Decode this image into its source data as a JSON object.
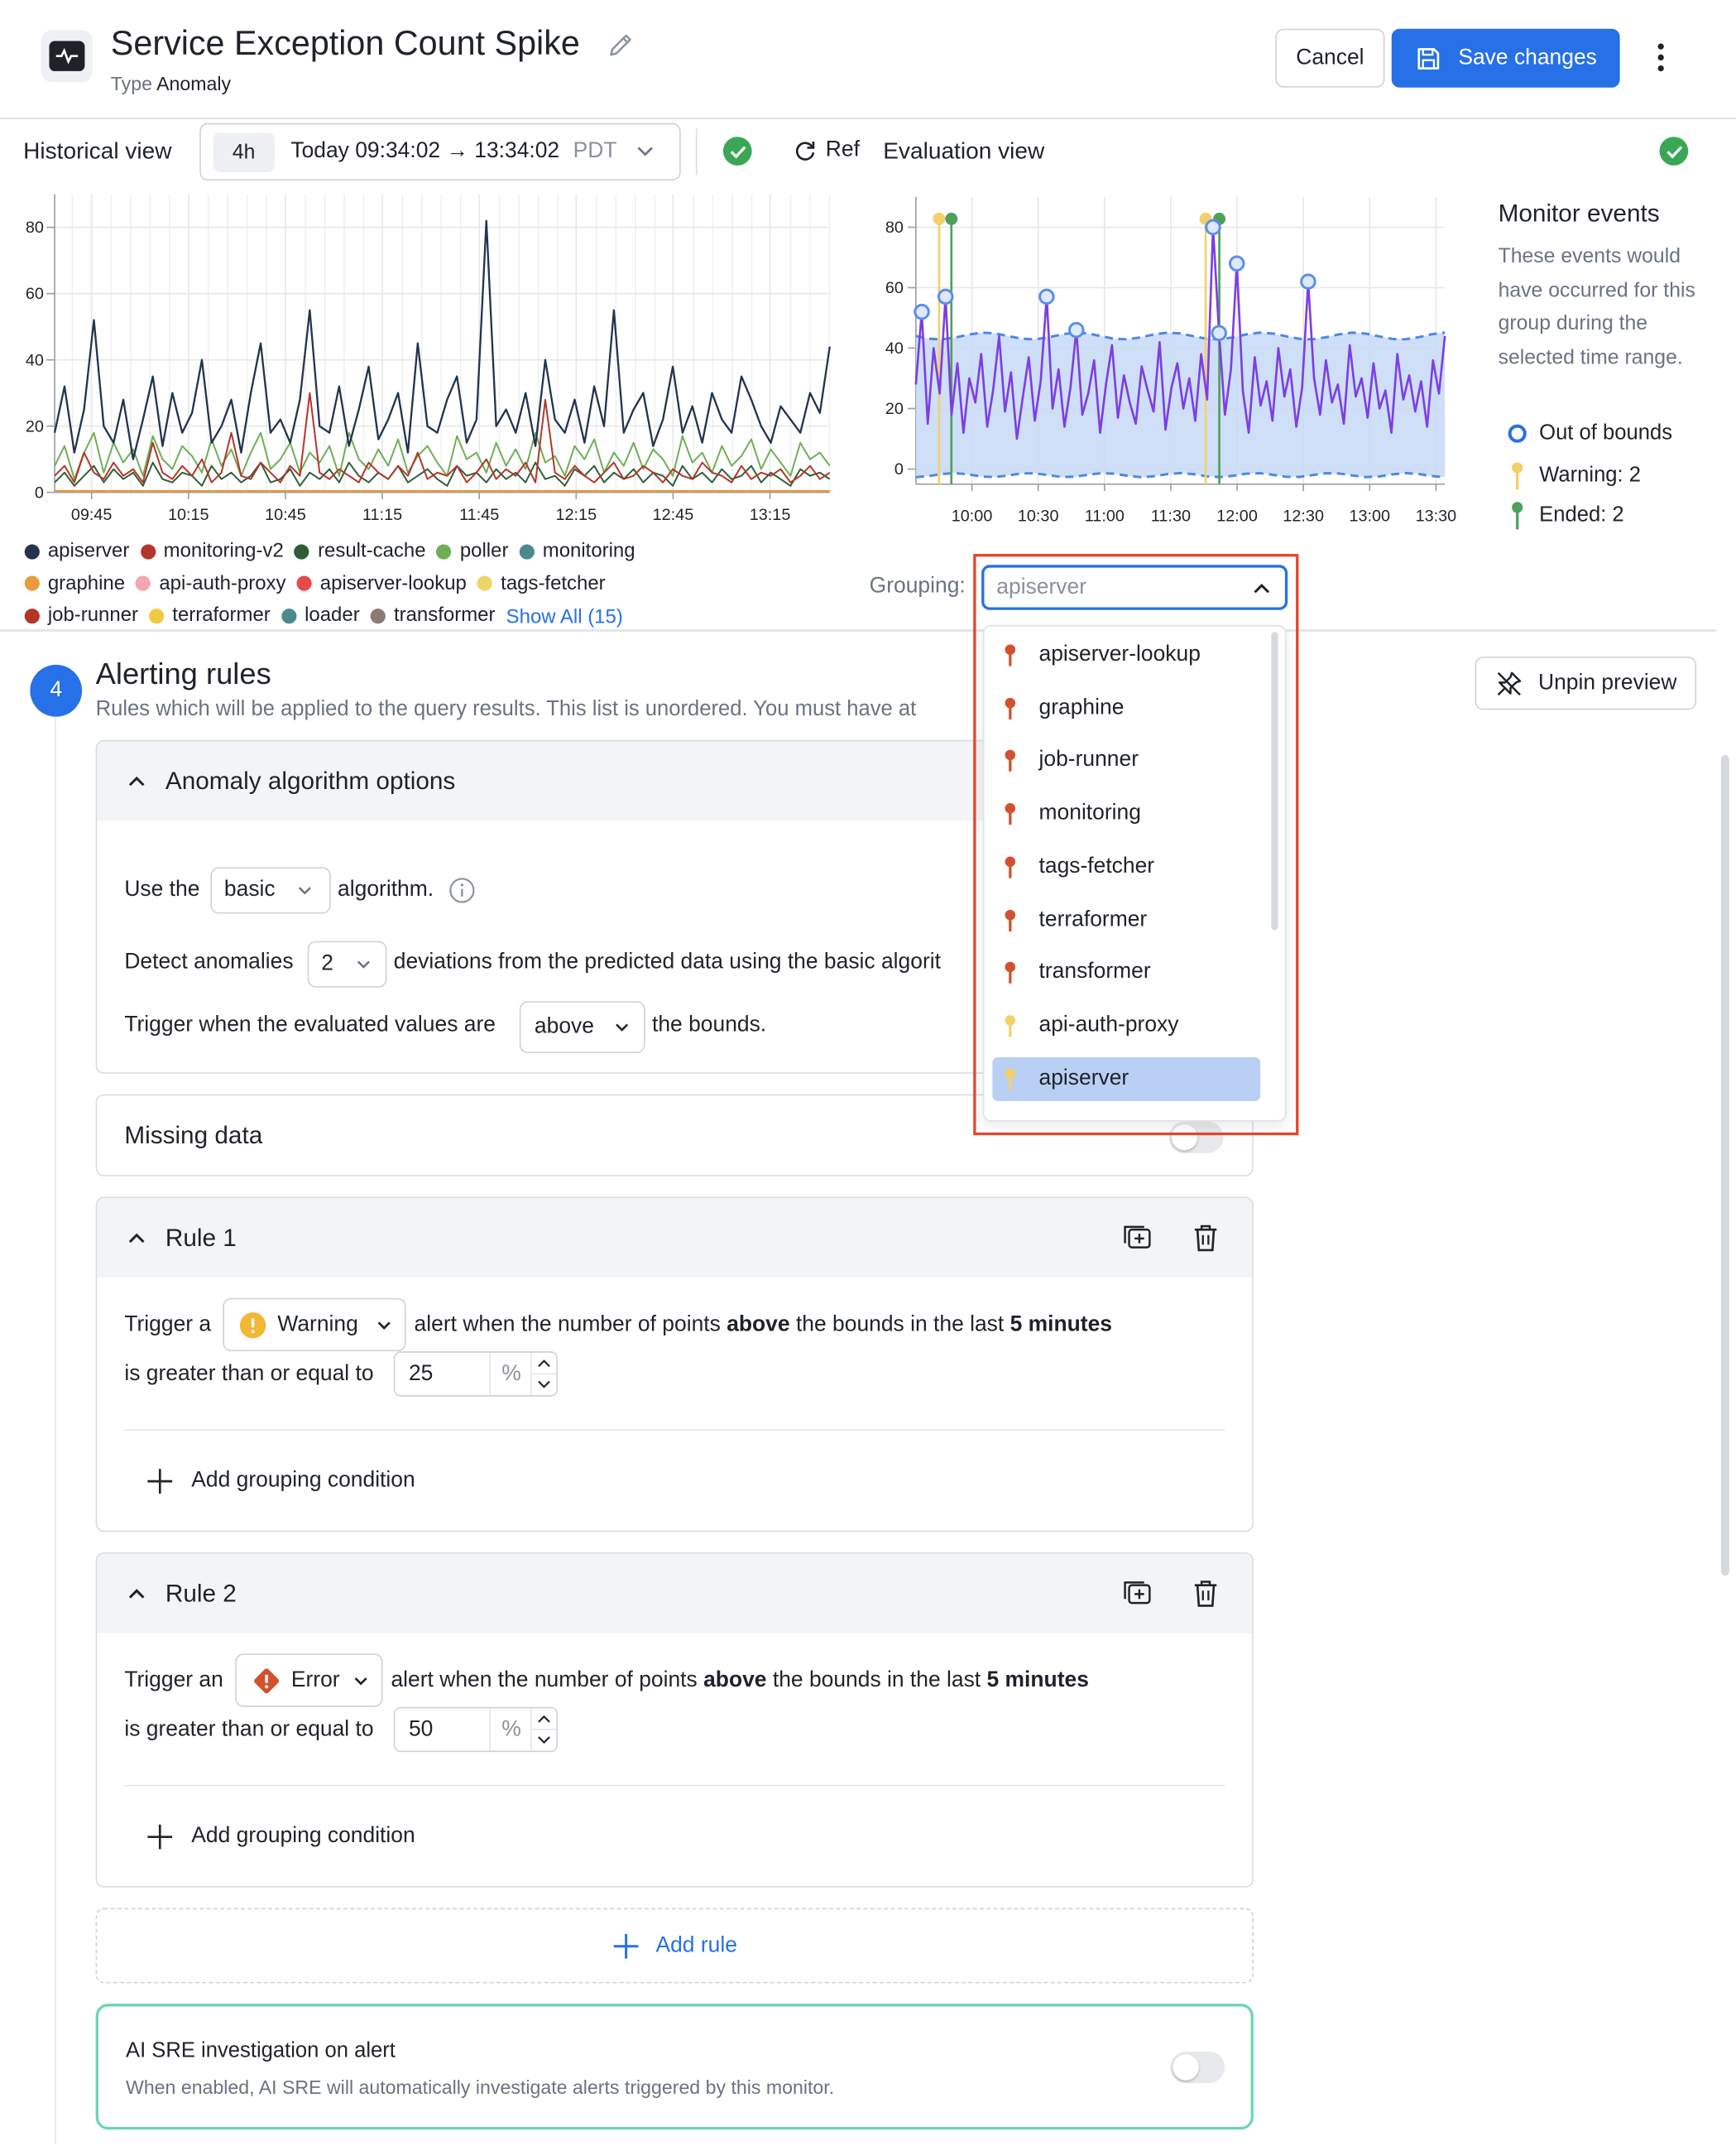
{
  "header": {
    "title": "Service Exception Count Spike",
    "type_label": "Type",
    "type_value": "Anomaly",
    "cancel_label": "Cancel",
    "save_label": "Save changes"
  },
  "historical": {
    "label": "Historical view",
    "range_pill": "4h",
    "range_text": "Today 09:34:02 → 13:34:02",
    "timezone": "PDT",
    "refresh_label": "Ref"
  },
  "evaluation": {
    "label": "Evaluation view"
  },
  "legend": {
    "items": [
      {
        "name": "apiserver",
        "color": "#24344d"
      },
      {
        "name": "monitoring-v2",
        "color": "#b2362a"
      },
      {
        "name": "result-cache",
        "color": "#2f5e35"
      },
      {
        "name": "poller",
        "color": "#6fae55"
      },
      {
        "name": "monitoring",
        "color": "#4d8a8a"
      },
      {
        "name": "graphine",
        "color": "#e89a3c"
      },
      {
        "name": "api-auth-proxy",
        "color": "#f3a5b0"
      },
      {
        "name": "apiserver-lookup",
        "color": "#e84a4a"
      },
      {
        "name": "tags-fetcher",
        "color": "#ecd66a"
      },
      {
        "name": "job-runner",
        "color": "#b2362a"
      },
      {
        "name": "terraformer",
        "color": "#f0c842"
      },
      {
        "name": "loader",
        "color": "#4d8a8a"
      },
      {
        "name": "transformer",
        "color": "#8c7a74"
      }
    ],
    "show_all": "Show All (15)"
  },
  "monitor_events": {
    "title": "Monitor events",
    "description": "These events would have occurred for this group during the selected time range.",
    "out_of_bounds": "Out of bounds",
    "warning": "Warning: 2",
    "ended": "Ended: 2"
  },
  "grouping": {
    "label": "Grouping:",
    "value": "apiserver",
    "options": [
      {
        "name": "apiserver-lookup",
        "pin": "red"
      },
      {
        "name": "graphine",
        "pin": "red"
      },
      {
        "name": "job-runner",
        "pin": "red"
      },
      {
        "name": "monitoring",
        "pin": "red"
      },
      {
        "name": "tags-fetcher",
        "pin": "red"
      },
      {
        "name": "terraformer",
        "pin": "red"
      },
      {
        "name": "transformer",
        "pin": "red"
      },
      {
        "name": "api-auth-proxy",
        "pin": "yellow"
      },
      {
        "name": "apiserver",
        "pin": "yellow"
      }
    ]
  },
  "alerting": {
    "step": "4",
    "title": "Alerting rules",
    "subtitle": "Rules which will be applied to the query results. This list is unordered. You must have at",
    "unpin_label": "Unpin preview",
    "anomaly": {
      "title": "Anomaly algorithm options",
      "use_the": "Use the",
      "algorithm": "basic",
      "algorithm_suffix": "algorithm.",
      "detect_prefix": "Detect anomalies",
      "deviations": "2",
      "detect_suffix": "deviations from the predicted data using the basic algorit",
      "trigger_prefix": "Trigger when the evaluated values are",
      "direction": "above",
      "trigger_suffix": "the bounds."
    },
    "missing_data": "Missing data",
    "rules": [
      {
        "title": "Rule 1",
        "trigger_prefix": "Trigger a",
        "severity": "Warning",
        "text_a": "alert when the number of points",
        "bold_a": "above",
        "text_b": "the bounds in the last",
        "bold_b": "5 minutes",
        "gte": "is greater than or equal to",
        "value": "25",
        "unit": "%",
        "add_grouping": "Add grouping condition"
      },
      {
        "title": "Rule 2",
        "trigger_prefix": "Trigger an",
        "severity": "Error",
        "text_a": "alert when the number of points",
        "bold_a": "above",
        "text_b": "the bounds in the last",
        "bold_b": "5 minutes",
        "gte": "is greater than or equal to",
        "value": "50",
        "unit": "%",
        "add_grouping": "Add grouping condition"
      }
    ],
    "add_rule": "Add rule",
    "ai_sre": {
      "title": "AI SRE investigation on alert",
      "description": "When enabled, AI SRE will automatically investigate alerts triggered by this monitor."
    }
  },
  "chart_data": [
    {
      "type": "line",
      "x_ticks": [
        "09:45",
        "10:15",
        "10:45",
        "11:15",
        "11:45",
        "12:15",
        "12:45",
        "13:15"
      ],
      "y_ticks": [
        0,
        20,
        40,
        60,
        80
      ],
      "ylim": [
        0,
        90
      ],
      "series": [
        {
          "name": "apiserver",
          "color": "#24344d",
          "values": [
            18,
            32,
            12,
            25,
            52,
            20,
            15,
            28,
            10,
            22,
            35,
            14,
            30,
            18,
            24,
            40,
            15,
            20,
            28,
            12,
            30,
            45,
            18,
            22,
            15,
            28,
            55,
            20,
            18,
            32,
            14,
            25,
            38,
            16,
            22,
            30,
            12,
            45,
            20,
            18,
            28,
            35,
            15,
            22,
            82,
            20,
            25,
            18,
            30,
            14,
            40,
            22,
            18,
            28,
            15,
            32,
            20,
            55,
            18,
            25,
            30,
            14,
            22,
            38,
            18,
            26,
            15,
            30,
            22,
            18,
            35,
            28,
            20,
            15,
            26,
            22,
            18,
            30,
            24,
            44
          ]
        },
        {
          "name": "monitoring-v2",
          "color": "#b2362a",
          "values": [
            5,
            8,
            3,
            12,
            6,
            4,
            9,
            5,
            7,
            3,
            15,
            6,
            4,
            8,
            5,
            10,
            3,
            6,
            18,
            5,
            4,
            9,
            6,
            3,
            8,
            5,
            30,
            6,
            4,
            7,
            5,
            3,
            9,
            6,
            4,
            8,
            5,
            12,
            4,
            6,
            5,
            8,
            3,
            6,
            10,
            4,
            7,
            5,
            9,
            3,
            28,
            6,
            4,
            8,
            5,
            3,
            6,
            9,
            4,
            5,
            8,
            6,
            3,
            7,
            5,
            4,
            9,
            6,
            5,
            3,
            8,
            4,
            6,
            5,
            7,
            3,
            5,
            8,
            4,
            6
          ]
        },
        {
          "name": "poller",
          "color": "#6fae55",
          "values": [
            8,
            14,
            4,
            12,
            18,
            6,
            15,
            9,
            13,
            5,
            17,
            10,
            7,
            14,
            11,
            6,
            16,
            8,
            13,
            5,
            12,
            18,
            7,
            10,
            15,
            6,
            12,
            9,
            14,
            5,
            18,
            10,
            7,
            13,
            8,
            16,
            6,
            11,
            14,
            9,
            5,
            17,
            10,
            12,
            6,
            15,
            8,
            13,
            7,
            18,
            9,
            11,
            5,
            14,
            10,
            16,
            6,
            12,
            8,
            15,
            7,
            13,
            10,
            5,
            17,
            9,
            12,
            6,
            14,
            8,
            11,
            16,
            7,
            13,
            9,
            5,
            15,
            10,
            12,
            8
          ]
        },
        {
          "name": "result-cache",
          "color": "#2f5e35",
          "values": [
            3,
            6,
            2,
            5,
            8,
            3,
            7,
            4,
            6,
            2,
            9,
            4,
            3,
            6,
            5,
            2,
            8,
            4,
            6,
            3,
            5,
            9,
            3,
            4,
            7,
            2,
            6,
            4,
            7,
            3,
            9,
            5,
            3,
            6,
            4,
            8,
            3,
            5,
            7,
            4,
            2,
            8,
            5,
            6,
            3,
            7,
            4,
            6,
            3,
            9,
            4,
            5,
            2,
            7,
            5,
            8,
            3,
            6,
            4,
            7,
            3,
            6,
            5,
            2,
            8,
            4,
            6,
            3,
            7,
            4,
            5,
            8,
            3,
            6,
            4,
            2,
            7,
            5,
            6,
            4
          ]
        }
      ]
    },
    {
      "type": "line",
      "series_name": "apiserver",
      "x_ticks": [
        "10:00",
        "10:30",
        "11:00",
        "11:30",
        "12:00",
        "12:30",
        "13:00",
        "13:30"
      ],
      "y_ticks": [
        0,
        20,
        40,
        60,
        80
      ],
      "ylim": [
        -5,
        90
      ],
      "bounds_upper": 44,
      "bounds_lower": -2,
      "values": [
        28,
        52,
        15,
        40,
        25,
        57,
        18,
        35,
        12,
        30,
        22,
        38,
        14,
        26,
        44,
        19,
        32,
        10,
        24,
        37,
        16,
        29,
        57,
        20,
        33,
        14,
        27,
        46,
        18,
        25,
        36,
        12,
        28,
        41,
        17,
        31,
        22,
        15,
        34,
        26,
        19,
        42,
        13,
        27,
        35,
        20,
        30,
        16,
        38,
        23,
        80,
        45,
        18,
        33,
        68,
        26,
        12,
        37,
        21,
        29,
        16,
        40,
        24,
        33,
        14,
        27,
        62,
        30,
        18,
        36,
        22,
        28,
        15,
        41,
        24,
        30,
        17,
        35,
        20,
        26,
        12,
        38,
        23,
        31,
        19,
        29,
        14,
        36,
        25,
        44
      ],
      "out_of_bounds_values": [
        50,
        56,
        57,
        49,
        80,
        45,
        68,
        62
      ],
      "warning_markers": 2,
      "ended_markers": 2
    }
  ]
}
